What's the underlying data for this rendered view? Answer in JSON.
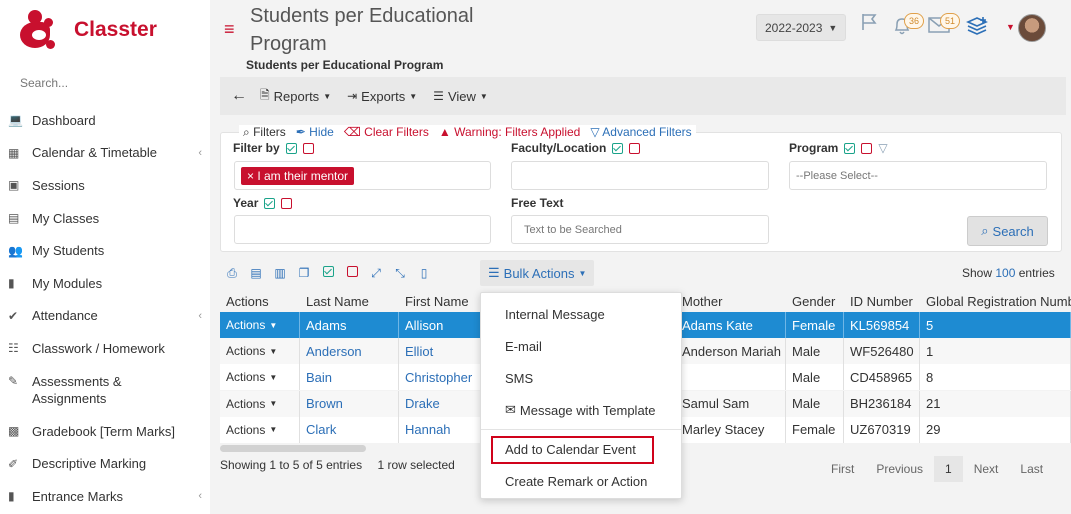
{
  "brand": {
    "name": "Classter",
    "color": "#c8102e"
  },
  "sidebar": {
    "search_placeholder": "Search...",
    "items": [
      {
        "label": "Dashboard",
        "icon": "laptop-icon",
        "chevron": false
      },
      {
        "label": "Calendar & Timetable",
        "icon": "calendar-icon",
        "chevron": true
      },
      {
        "label": "Sessions",
        "icon": "sessions-icon",
        "chevron": false
      },
      {
        "label": "My Classes",
        "icon": "classes-icon",
        "chevron": false
      },
      {
        "label": "My Students",
        "icon": "students-icon",
        "chevron": false
      },
      {
        "label": "My Modules",
        "icon": "book-icon",
        "chevron": false
      },
      {
        "label": "Attendance",
        "icon": "attendance-icon",
        "chevron": true
      },
      {
        "label": "Classwork / Homework",
        "icon": "list-icon",
        "chevron": false
      },
      {
        "label": "Assessments & Assignments",
        "icon": "edit-icon",
        "chevron": false
      },
      {
        "label": "Gradebook [Term Marks]",
        "icon": "gradebook-icon",
        "chevron": false
      },
      {
        "label": "Descriptive Marking",
        "icon": "pen-icon",
        "chevron": false
      },
      {
        "label": "Entrance Marks",
        "icon": "clipboard-icon",
        "chevron": true
      }
    ]
  },
  "header": {
    "title": "Students per Educational Program",
    "subtitle": "Students per Educational Program",
    "year": "2022-2023",
    "notifications_count": "36",
    "messages_count": "51"
  },
  "toolbar": {
    "reports": "Reports",
    "exports": "Exports",
    "view": "View"
  },
  "filters": {
    "title": "Filters",
    "hide": "Hide",
    "clear": "Clear Filters",
    "warning": "Warning: Filters Applied",
    "advanced": "Advanced Filters",
    "filter_by_label": "Filter by",
    "filter_by_tag": "I am their mentor",
    "faculty_label": "Faculty/Location",
    "program_label": "Program",
    "program_placeholder": "--Please Select--",
    "year_label": "Year",
    "free_text_label": "Free Text",
    "free_text_placeholder": "Text to be Searched",
    "search_button": "Search"
  },
  "table": {
    "bulk_actions": "Bulk Actions",
    "show_prefix": "Show",
    "show_count": "100",
    "show_suffix": "entries",
    "columns": [
      "Actions",
      "Last Name",
      "First Name",
      "Mother",
      "Gender",
      "ID Number",
      "Global Registration Number"
    ],
    "rows": [
      {
        "actions": "Actions",
        "last": "Adams",
        "first": "Allison",
        "mother": "Adams Kate",
        "gender": "Female",
        "id": "KL569854",
        "grn": "5",
        "selected": true
      },
      {
        "actions": "Actions",
        "last": "Anderson",
        "first": "Elliot",
        "mother": "Anderson Mariah",
        "gender": "Male",
        "id": "WF526480",
        "grn": "1",
        "selected": false
      },
      {
        "actions": "Actions",
        "last": "Bain",
        "first": "Christopher",
        "mother": "",
        "gender": "Male",
        "id": "CD458965",
        "grn": "8",
        "selected": false
      },
      {
        "actions": "Actions",
        "last": "Brown",
        "first": "Drake",
        "mother": "Samul Sam",
        "gender": "Male",
        "id": "BH236184",
        "grn": "21",
        "selected": false
      },
      {
        "actions": "Actions",
        "last": "Clark",
        "first": "Hannah",
        "mother": "Marley Stacey",
        "gender": "Female",
        "id": "UZ670319",
        "grn": "29",
        "selected": false
      }
    ],
    "info": "Showing 1 to 5 of 5 entries",
    "selected_info": "1 row selected",
    "pager": {
      "first": "First",
      "previous": "Previous",
      "current": "1",
      "next": "Next",
      "last": "Last"
    }
  },
  "bulk_menu": {
    "items": [
      "Internal Message",
      "E-mail",
      "SMS",
      "Message with Template",
      "Add to Calendar Event",
      "Create Remark or Action"
    ],
    "highlighted": "Add to Calendar Event"
  },
  "colors": {
    "accent": "#2c6fb7",
    "selected_row": "#1e8bd2",
    "highlight_border": "#d0021b"
  }
}
